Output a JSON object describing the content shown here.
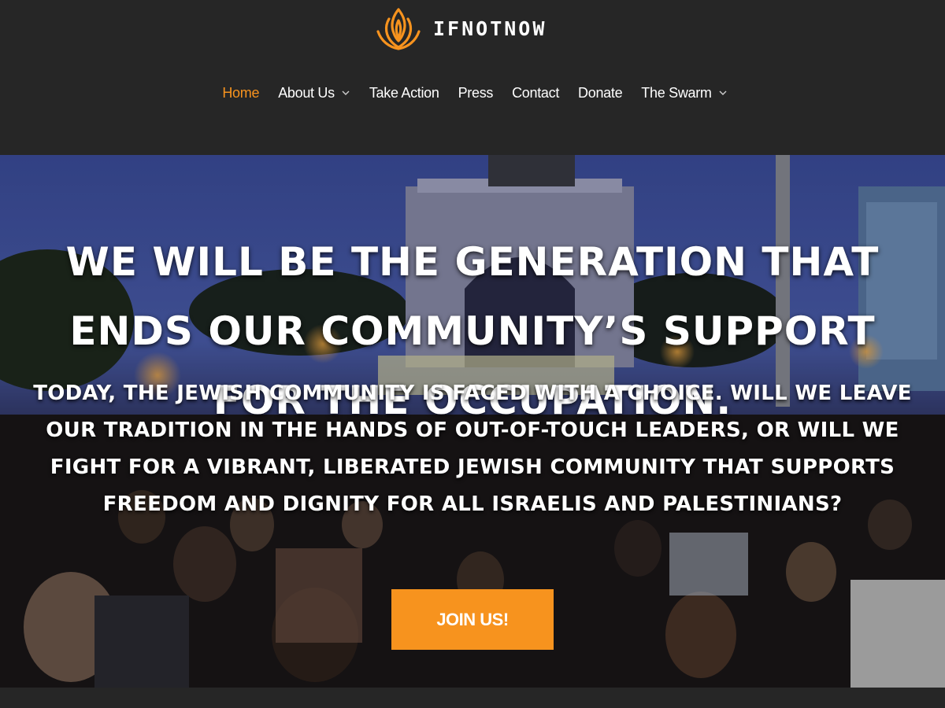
{
  "site": {
    "logo_text": "IFNOTNOW",
    "logo_icon": "flame-lotus-icon",
    "brand_color": "#f7931e"
  },
  "nav": {
    "items": [
      {
        "label": "Home",
        "active": true
      },
      {
        "label": "About Us",
        "has_dropdown": true
      },
      {
        "label": "Take Action"
      },
      {
        "label": "Press"
      },
      {
        "label": "Contact"
      },
      {
        "label": "Donate"
      },
      {
        "label": "The Swarm",
        "has_dropdown": true
      }
    ]
  },
  "hero": {
    "headline": "WE WILL BE THE GENERATION THAT ENDS OUR COMMUNITY’S SUPPORT FOR THE OCCUPATION.",
    "subtext": "TODAY, THE JEWISH COMMUNITY IS FACED WITH A CHOICE. WILL WE LEAVE OUR TRADITION IN THE HANDS OF OUT-OF-TOUCH LEADERS, OR WILL WE FIGHT FOR A VIBRANT, LIBERATED JEWISH COMMUNITY THAT SUPPORTS FREEDOM AND DIGNITY FOR ALL ISRAELIS AND PALESTINIANS?",
    "cta_label": "JOIN US!"
  }
}
